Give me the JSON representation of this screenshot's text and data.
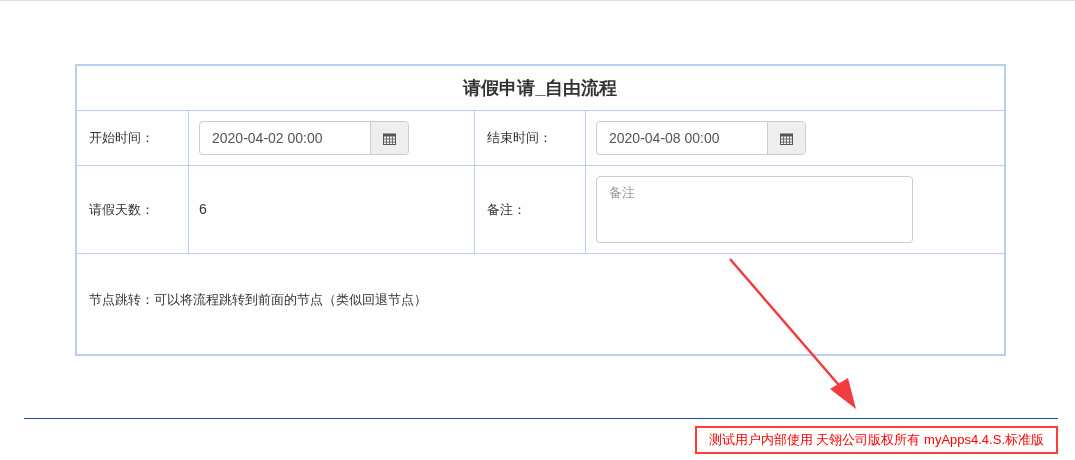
{
  "form": {
    "title": "请假申请_自由流程",
    "rows": [
      [
        {
          "label": "开始时间：",
          "kind": "date",
          "value": "2020-04-02 00:00"
        },
        {
          "label": "结束时间：",
          "kind": "date",
          "value": "2020-04-08 00:00"
        }
      ],
      [
        {
          "label": "请假天数：",
          "kind": "text",
          "value": "6"
        },
        {
          "label": "备注：",
          "kind": "textarea",
          "placeholder": "备注"
        }
      ]
    ],
    "note": "节点跳转：可以将流程跳转到前面的节点（类似回退节点）"
  },
  "footer": {
    "text": "测试用户内部使用 天翎公司版权所有 myApps4.4.S.标准版"
  }
}
